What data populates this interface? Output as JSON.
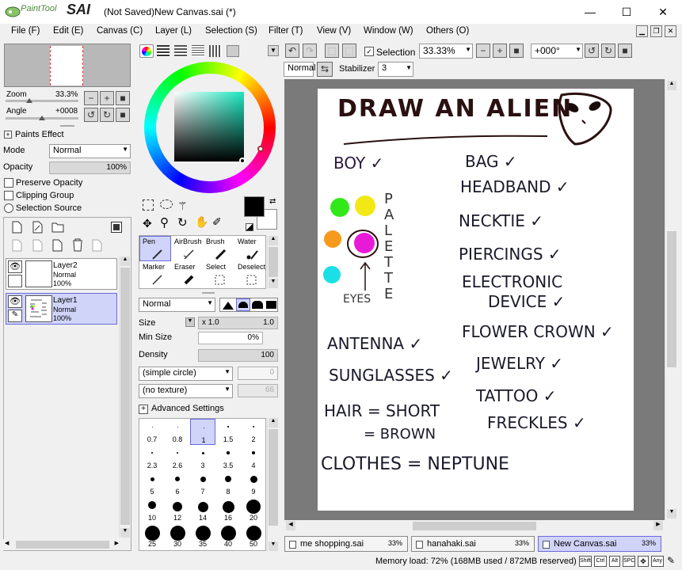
{
  "app": {
    "logo_small": "PaintTool",
    "logo_big": "SAI",
    "title": "(Not Saved)New Canvas.sai (*)"
  },
  "window_controls": {
    "minimize": "—",
    "maximize": "☐",
    "close": "✕"
  },
  "menu": [
    "File (F)",
    "Edit (E)",
    "Canvas (C)",
    "Layer (L)",
    "Selection (S)",
    "Filter (T)",
    "View (V)",
    "Window (W)",
    "Others (O)"
  ],
  "navigator": {
    "zoom_label": "Zoom",
    "zoom_value": "33.3%",
    "angle_label": "Angle",
    "angle_value": "+0008"
  },
  "paints_effect": {
    "header": "Paints Effect",
    "mode_label": "Mode",
    "mode_value": "Normal",
    "opacity_label": "Opacity",
    "opacity_value": "100%",
    "preserve_opacity": "Preserve Opacity",
    "clipping_group": "Clipping Group",
    "selection_source": "Selection Source"
  },
  "layers": [
    {
      "name": "Layer2",
      "mode": "Normal",
      "opacity": "100%",
      "selected": false
    },
    {
      "name": "Layer1",
      "mode": "Normal",
      "opacity": "100%",
      "selected": true
    }
  ],
  "tools": [
    {
      "name": "Pen",
      "selected": true
    },
    {
      "name": "AirBrush"
    },
    {
      "name": "Brush"
    },
    {
      "name": "Water"
    },
    {
      "name": "Marker"
    },
    {
      "name": "Eraser"
    },
    {
      "name": "Select"
    },
    {
      "name": "Deselect"
    }
  ],
  "brush": {
    "blend_mode": "Normal",
    "size_label": "Size",
    "size_multiplier": "x 1.0",
    "size_value": "1.0",
    "min_size_label": "Min Size",
    "min_size_value": "0%",
    "density_label": "Density",
    "density_value": "100",
    "shape": "(simple circle)",
    "shape_value": "0",
    "texture": "(no texture)",
    "texture_value": "66",
    "advanced": "Advanced Settings",
    "sizes": [
      "0.7",
      "0.8",
      "1",
      "1.5",
      "2",
      "2.3",
      "2.6",
      "3",
      "3.5",
      "4",
      "5",
      "6",
      "7",
      "8",
      "9",
      "10",
      "12",
      "14",
      "16",
      "20",
      "25",
      "30",
      "35",
      "40",
      "50"
    ],
    "selected_size": "1"
  },
  "toolbar": {
    "selection_label": "Selection",
    "zoom_value": "33.33%",
    "rotation_value": "+000°",
    "blend_mode": "Normal",
    "stabilizer_label": "Stabilizer",
    "stabilizer_value": "3"
  },
  "canvas_text": {
    "title": "DRAW AN ALIEN",
    "boy": "BOY ✓",
    "bag": "BAG ✓",
    "headband": "HEADBAND ✓",
    "necktie": "NECKTIE ✓",
    "piercings": "PIERCINGS ✓",
    "electronic": "ELECTRONIC",
    "device": "DEVICE ✓",
    "palette": "PALETTE",
    "eyes": "EYES",
    "antenna": "ANTENNA ✓",
    "sunglasses": "SUNGLASSES ✓",
    "flower_crown": "FLOWER CROWN ✓",
    "jewelry": "JEWELRY ✓",
    "tattoo": "TATTOO ✓",
    "freckles": "FRECKLES ✓",
    "hair1": "HAIR = SHORT",
    "hair2": "= BROWN",
    "clothes": "CLOTHES = NEPTUNE"
  },
  "tabs": [
    {
      "name": "me shopping.sai",
      "zoom": "33%",
      "active": false
    },
    {
      "name": "hanahaki.sai",
      "zoom": "33%",
      "active": false
    },
    {
      "name": "New Canvas.sai",
      "zoom": "33%",
      "active": true
    }
  ],
  "status": {
    "memory": "Memory load: 72% (168MB used / 872MB reserved)",
    "keys": [
      "Shift",
      "Ctrl",
      "Alt",
      "SPC",
      "Any"
    ]
  },
  "colors": {
    "accent": "#d0d4f8",
    "selected_border": "#6a6adc",
    "canvas_bg": "#7a7a7a"
  }
}
